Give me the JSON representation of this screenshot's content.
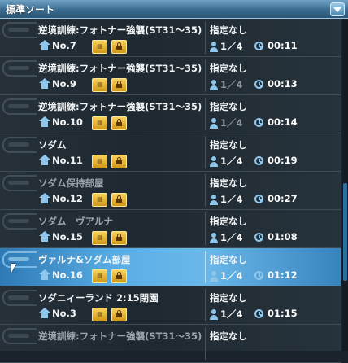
{
  "header": {
    "title": "標準ソート"
  },
  "rows": [
    {
      "name": "逆境訓練:フォトナー強襲(ST31～35)",
      "no": "No.7",
      "cond": "指定なし",
      "players": "1／4",
      "time": "00:11",
      "dim_players": false
    },
    {
      "name": "逆境訓練:フォトナー強襲(ST31～35)",
      "no": "No.9",
      "cond": "指定なし",
      "players": "1／4",
      "time": "00:13",
      "dim_players": true
    },
    {
      "name": "逆境訓練:フォトナー強襲(ST31～35)",
      "no": "No.10",
      "cond": "指定なし",
      "players": "1／4",
      "time": "00:14",
      "dim_players": true
    },
    {
      "name": "ソダム",
      "no": "No.11",
      "cond": "指定なし",
      "players": "1／4",
      "time": "00:19",
      "dim_players": false
    },
    {
      "name": "ソダム保持部屋",
      "no": "No.12",
      "cond": "指定なし",
      "players": "1／4",
      "time": "00:27",
      "dim_players": false
    },
    {
      "name": "ソダム　ヴアルナ",
      "no": "No.15",
      "cond": "指定なし",
      "players": "1／4",
      "time": "01:08",
      "dim_players": false
    },
    {
      "name": "ヴァルナ&ソダム部屋",
      "no": "No.16",
      "cond": "指定なし",
      "players": "1／4",
      "time": "01:12",
      "dim_players": false,
      "selected": true
    },
    {
      "name": "ソダニィーランド 2:15閉園",
      "no": "No.3",
      "cond": "指定なし",
      "players": "1／4",
      "time": "01:15",
      "dim_players": false
    },
    {
      "name": "逆境訓練:フォトナー強襲(ST31～35)",
      "no": "",
      "cond": "指定なし",
      "players": "",
      "time": "",
      "dim_players": false
    }
  ],
  "icons": {
    "home": "home-icon",
    "quest": "quest-ticket-icon",
    "lock": "lock-icon",
    "person": "person-icon",
    "clock": "clock-icon"
  }
}
